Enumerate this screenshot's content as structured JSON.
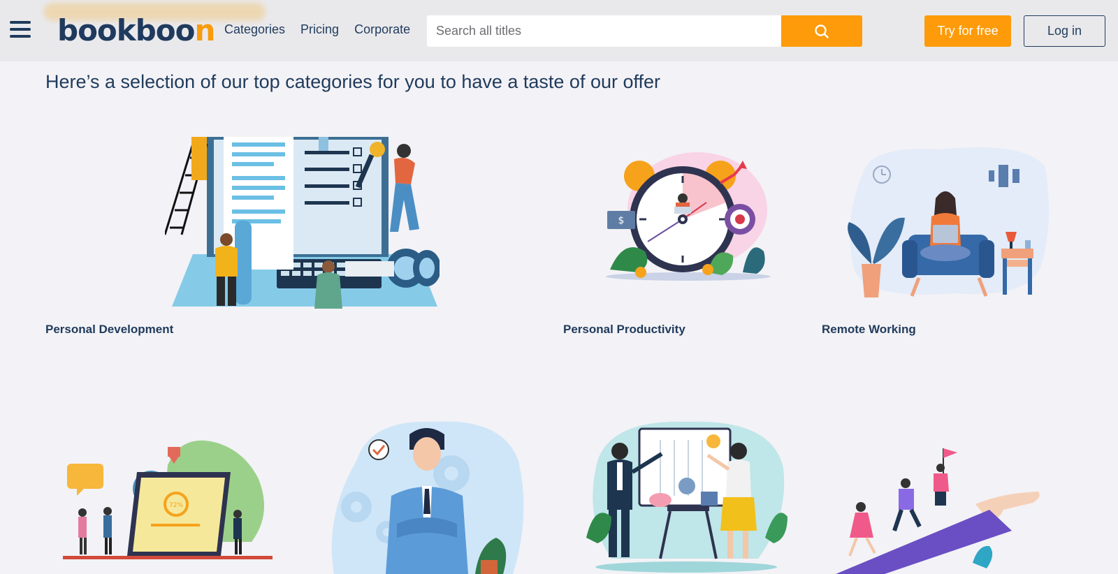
{
  "header": {
    "logo_main": "bookboo",
    "logo_accent": "n",
    "nav": [
      "Categories",
      "Pricing",
      "Corporate"
    ],
    "search_placeholder": "Search all titles",
    "try_label": "Try for free",
    "login_label": "Log in"
  },
  "main": {
    "heading": "Here’s a selection of our top categories for you to have a taste of our offer",
    "categories": [
      {
        "title": "Personal Development",
        "illustration": "workspace-illustration"
      },
      {
        "title": "Personal Productivity",
        "illustration": "clock-illustration"
      },
      {
        "title": "Remote Working",
        "illustration": "home-office-illustration"
      }
    ]
  },
  "colors": {
    "accent": "#fd9b0b",
    "navy": "#1f3b5c",
    "header_bg": "#e9e9ec",
    "page_bg": "#f3f2f6"
  },
  "icons": [
    "menu-icon",
    "search-icon"
  ]
}
